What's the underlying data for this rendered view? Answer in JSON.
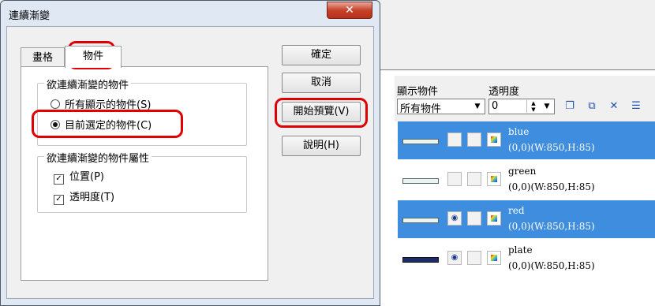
{
  "dialog": {
    "title": "連續漸變",
    "close_glyph": "✕",
    "tabs": [
      {
        "label": "畫格"
      },
      {
        "label": "物件"
      }
    ],
    "target_group": {
      "title": "欲連續漸變的物件",
      "options": [
        {
          "label": "所有顯示的物件(S)",
          "checked": false
        },
        {
          "label": "目前選定的物件(C)",
          "checked": true
        }
      ]
    },
    "attr_group": {
      "title": "欲連續漸變的物件屬性",
      "options": [
        {
          "label": "位置(P)",
          "checked": true
        },
        {
          "label": "透明度(T)",
          "checked": true
        }
      ]
    },
    "buttons": {
      "ok": "確定",
      "cancel": "取消",
      "preview": "開始預覽(V)",
      "help": "說明(H)"
    }
  },
  "right_panel": {
    "show_objects_label": "顯示物件",
    "show_objects_value": "所有物件",
    "opacity_label": "透明度",
    "opacity_value": "0",
    "toolbar_icons": [
      "new-layer-icon",
      "copy-layer-icon",
      "delete-icon",
      "properties-icon"
    ],
    "objects": [
      {
        "name": "blue",
        "info": "(0,0)(W:850,H:85)",
        "selected": true,
        "visible": false
      },
      {
        "name": "green",
        "info": "(0,0)(W:850,H:85)",
        "selected": false,
        "visible": false
      },
      {
        "name": "red",
        "info": "(0,0)(W:850,H:85)",
        "selected": true,
        "visible": true
      },
      {
        "name": "plate",
        "info": "(0,0)(W:850,H:85)",
        "selected": false,
        "visible": true
      }
    ]
  },
  "colors": {
    "selection": "#3f8ddf",
    "highlight": "#e00000"
  }
}
